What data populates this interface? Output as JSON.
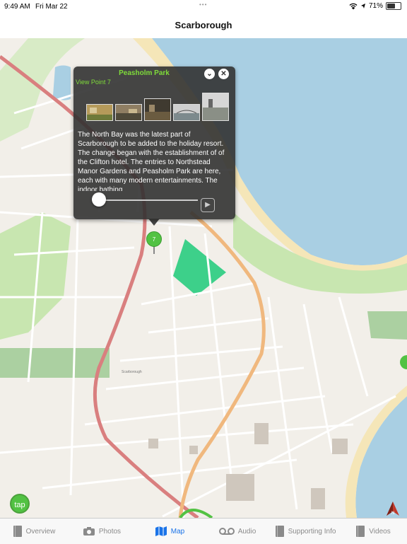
{
  "status_bar": {
    "time": "9:49 AM",
    "date": "Fri Mar 22",
    "battery_text": "71%",
    "battery_level": 0.71,
    "icons": [
      "wifi-icon",
      "location-arrow-icon",
      "battery-icon"
    ]
  },
  "nav": {
    "title": "Scarborough"
  },
  "popup": {
    "title": "Peasholm Park",
    "subtitle": "View Point 7",
    "collapse_icon": "chevron-down-icon",
    "close_icon": "close-icon",
    "description": "The North Bay was the latest part of Scarborough to be added to the holiday resort. The change began with the establishment of of the Clifton hotel. The entries to Northstead Manor Gardens and Peasholm Park are here, each with many modern entertainments. The indoor bathing",
    "audio_progress": 0,
    "play_icon": "play-icon"
  },
  "map": {
    "marker_label": "7",
    "area_label": "Scarborough",
    "sea_color": "#a9cfe3",
    "park_color": "#c8e6b0",
    "highlight_color": "#3dd08a",
    "road_primary_color": "#d97f7f",
    "road_secondary_color": "#f0b87e"
  },
  "tap_button": {
    "label": "tap"
  },
  "compass": {
    "label": "N",
    "icon": "compass-icon"
  },
  "tabs": [
    {
      "label": "Overview",
      "icon": "book-icon",
      "active": false
    },
    {
      "label": "Photos",
      "icon": "camera-icon",
      "active": false
    },
    {
      "label": "Map",
      "icon": "map-icon",
      "active": true
    },
    {
      "label": "Audio",
      "icon": "audio-icon",
      "active": false
    },
    {
      "label": "Supporting Info",
      "icon": "book-icon",
      "active": false
    },
    {
      "label": "Videos",
      "icon": "book-icon",
      "active": false
    }
  ],
  "colors": {
    "accent": "#1a73e8",
    "marker": "#52c243",
    "popup_title": "#7fdc3a"
  }
}
